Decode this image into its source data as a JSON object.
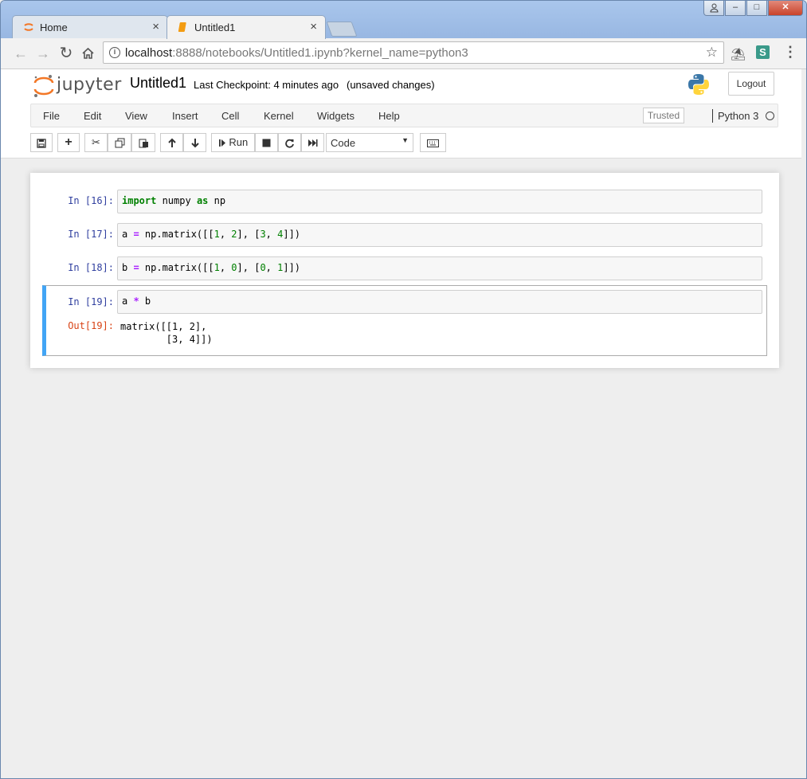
{
  "browser": {
    "tabs": [
      {
        "title": "Home",
        "active": false
      },
      {
        "title": "Untitled1",
        "active": true
      }
    ],
    "close_glyph": "×",
    "url_host": "localhost",
    "url_rest": ":8888/notebooks/Untitled1.ipynb?kernel_name=python3",
    "window_buttons": {
      "minimize": "–",
      "maximize": "□",
      "close": "✕"
    }
  },
  "jupyter": {
    "logo_text": "jupyter",
    "notebook_name": "Untitled1",
    "checkpoint": "Last Checkpoint: 4 minutes ago",
    "status": "(unsaved changes)",
    "logout_label": "Logout",
    "menu": [
      "File",
      "Edit",
      "View",
      "Insert",
      "Cell",
      "Kernel",
      "Widgets",
      "Help"
    ],
    "trusted_label": "Trusted",
    "kernel_name": "Python 3",
    "run_label": "Run",
    "cell_type": "Code"
  },
  "cells": [
    {
      "prompt": "In [16]:",
      "tokens": [
        [
          "kw",
          "import"
        ],
        [
          "t",
          " numpy "
        ],
        [
          "kw",
          "as"
        ],
        [
          "t",
          " np"
        ]
      ]
    },
    {
      "prompt": "In [17]:",
      "tokens": [
        [
          "t",
          "a "
        ],
        [
          "op",
          "="
        ],
        [
          "t",
          " np.matrix([["
        ],
        [
          "num",
          "1"
        ],
        [
          "t",
          ", "
        ],
        [
          "num",
          "2"
        ],
        [
          "t",
          "], ["
        ],
        [
          "num",
          "3"
        ],
        [
          "t",
          ", "
        ],
        [
          "num",
          "4"
        ],
        [
          "t",
          "]])"
        ]
      ]
    },
    {
      "prompt": "In [18]:",
      "tokens": [
        [
          "t",
          "b "
        ],
        [
          "op",
          "="
        ],
        [
          "t",
          " np.matrix([["
        ],
        [
          "num",
          "1"
        ],
        [
          "t",
          ", "
        ],
        [
          "num",
          "0"
        ],
        [
          "t",
          "], ["
        ],
        [
          "num",
          "0"
        ],
        [
          "t",
          ", "
        ],
        [
          "num",
          "1"
        ],
        [
          "t",
          "]])"
        ]
      ]
    },
    {
      "prompt": "In [19]:",
      "tokens": [
        [
          "t",
          "a "
        ],
        [
          "op",
          "*"
        ],
        [
          "t",
          " b"
        ]
      ],
      "out_prompt": "Out[19]:",
      "output": "matrix([[1, 2],\n        [3, 4]])"
    }
  ],
  "colors": {
    "selected_cell": "#42a5f5",
    "in_prompt": "#303f9f",
    "out_prompt": "#d84315",
    "keyword": "#008000"
  }
}
